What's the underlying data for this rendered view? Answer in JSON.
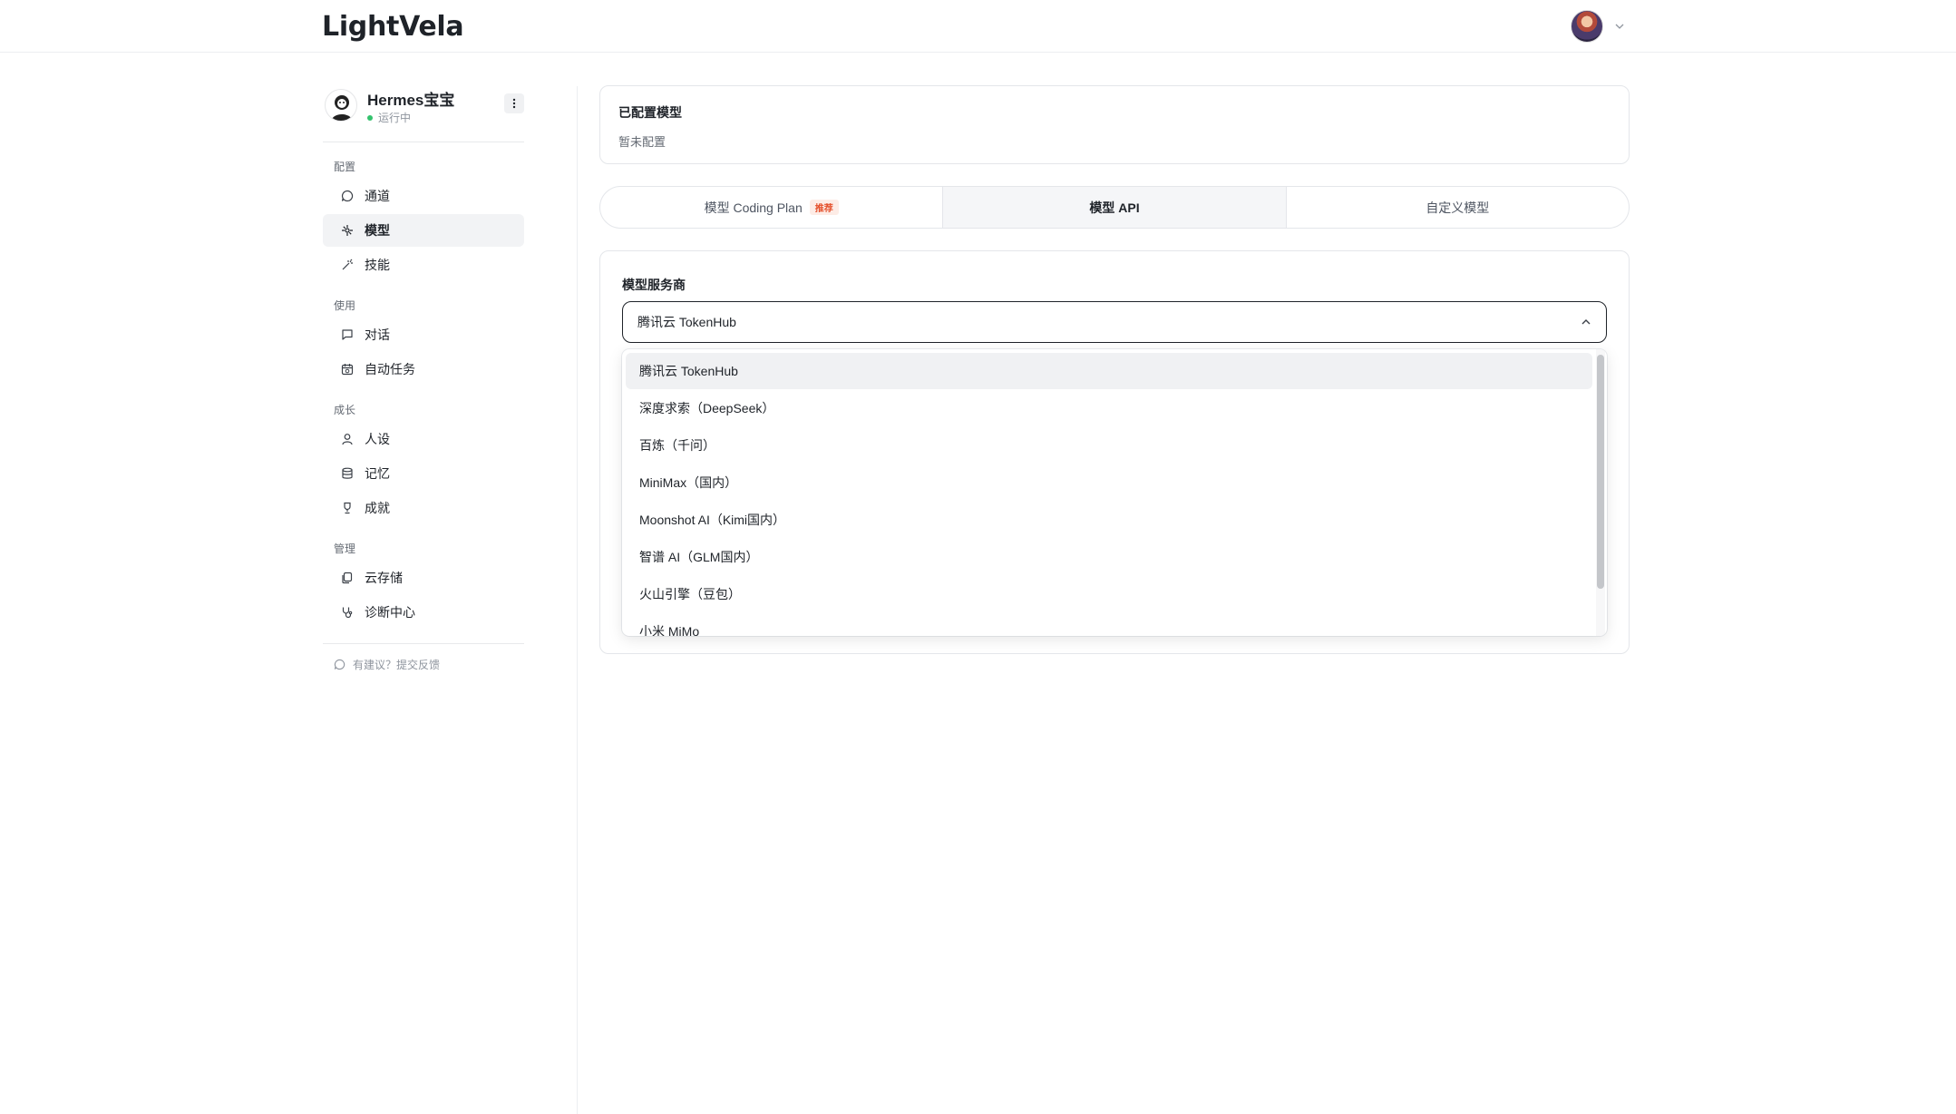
{
  "app": {
    "brand": "LightVela"
  },
  "profile": {
    "name": "Hermes宝宝",
    "status": "运行中"
  },
  "sidebar": {
    "groups": [
      {
        "label": "配置",
        "items": [
          {
            "label": "通道",
            "icon": "chat-bubble-icon"
          },
          {
            "label": "模型",
            "icon": "model-icon",
            "active": true
          },
          {
            "label": "技能",
            "icon": "magic-wand-icon"
          }
        ]
      },
      {
        "label": "使用",
        "items": [
          {
            "label": "对话",
            "icon": "message-square-icon"
          },
          {
            "label": "自动任务",
            "icon": "calendar-clock-icon"
          }
        ]
      },
      {
        "label": "成长",
        "items": [
          {
            "label": "人设",
            "icon": "user-icon"
          },
          {
            "label": "记忆",
            "icon": "database-icon"
          },
          {
            "label": "成就",
            "icon": "trophy-icon"
          }
        ]
      },
      {
        "label": "管理",
        "items": [
          {
            "label": "云存储",
            "icon": "cloud-storage-icon"
          },
          {
            "label": "诊断中心",
            "icon": "stethoscope-icon"
          }
        ]
      }
    ],
    "feedback": "有建议？提交反馈"
  },
  "configured": {
    "title": "已配置模型",
    "empty": "暂未配置"
  },
  "tabs": [
    {
      "label": "模型 Coding Plan",
      "badge": "推荐"
    },
    {
      "label": "模型 API",
      "active": true
    },
    {
      "label": "自定义模型"
    }
  ],
  "provider": {
    "label": "模型服务商",
    "selected": "腾讯云 TokenHub",
    "options": [
      "腾讯云 TokenHub",
      "深度求索（DeepSeek）",
      "百炼（千问）",
      "MiniMax（国内）",
      "Moonshot AI（Kimi国内）",
      "智谱 AI（GLM国内）",
      "火山引擎（豆包）",
      "小米 MiMo"
    ]
  }
}
